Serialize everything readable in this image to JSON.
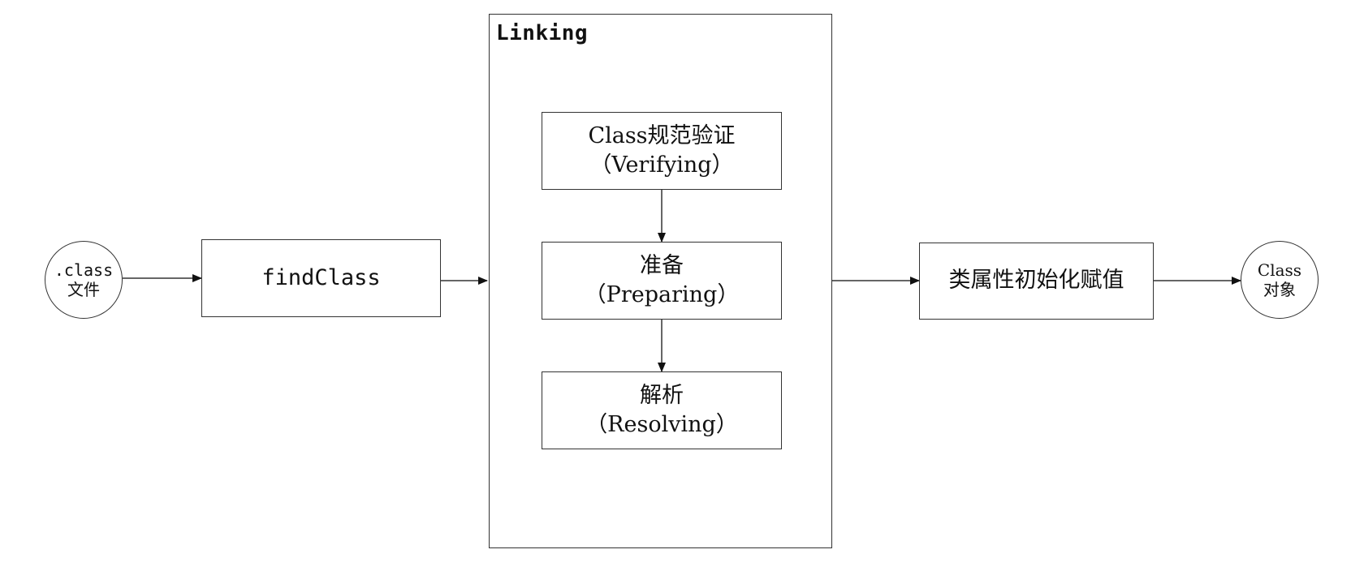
{
  "nodes": {
    "class_file": {
      "line1": ".class",
      "line2": "文件"
    },
    "find_class": {
      "label": "findClass"
    },
    "linking": {
      "label": "Linking"
    },
    "verifying": {
      "line1": "Class规范验证",
      "line2": "（Verifying）"
    },
    "preparing": {
      "line1": "准备",
      "line2": "（Preparing）"
    },
    "resolving": {
      "line1": "解析",
      "line2": "（Resolving）"
    },
    "init": {
      "label": "类属性初始化赋值"
    },
    "class_object": {
      "line1": "Class",
      "line2": "对象"
    }
  },
  "edges": [
    {
      "from": "class_file",
      "to": "find_class"
    },
    {
      "from": "find_class",
      "to": "linking"
    },
    {
      "from": "verifying",
      "to": "preparing"
    },
    {
      "from": "preparing",
      "to": "resolving"
    },
    {
      "from": "linking",
      "to": "init"
    },
    {
      "from": "init",
      "to": "class_object"
    }
  ],
  "colors": {
    "stroke": "#333333",
    "background": "#ffffff",
    "text": "#111111"
  }
}
